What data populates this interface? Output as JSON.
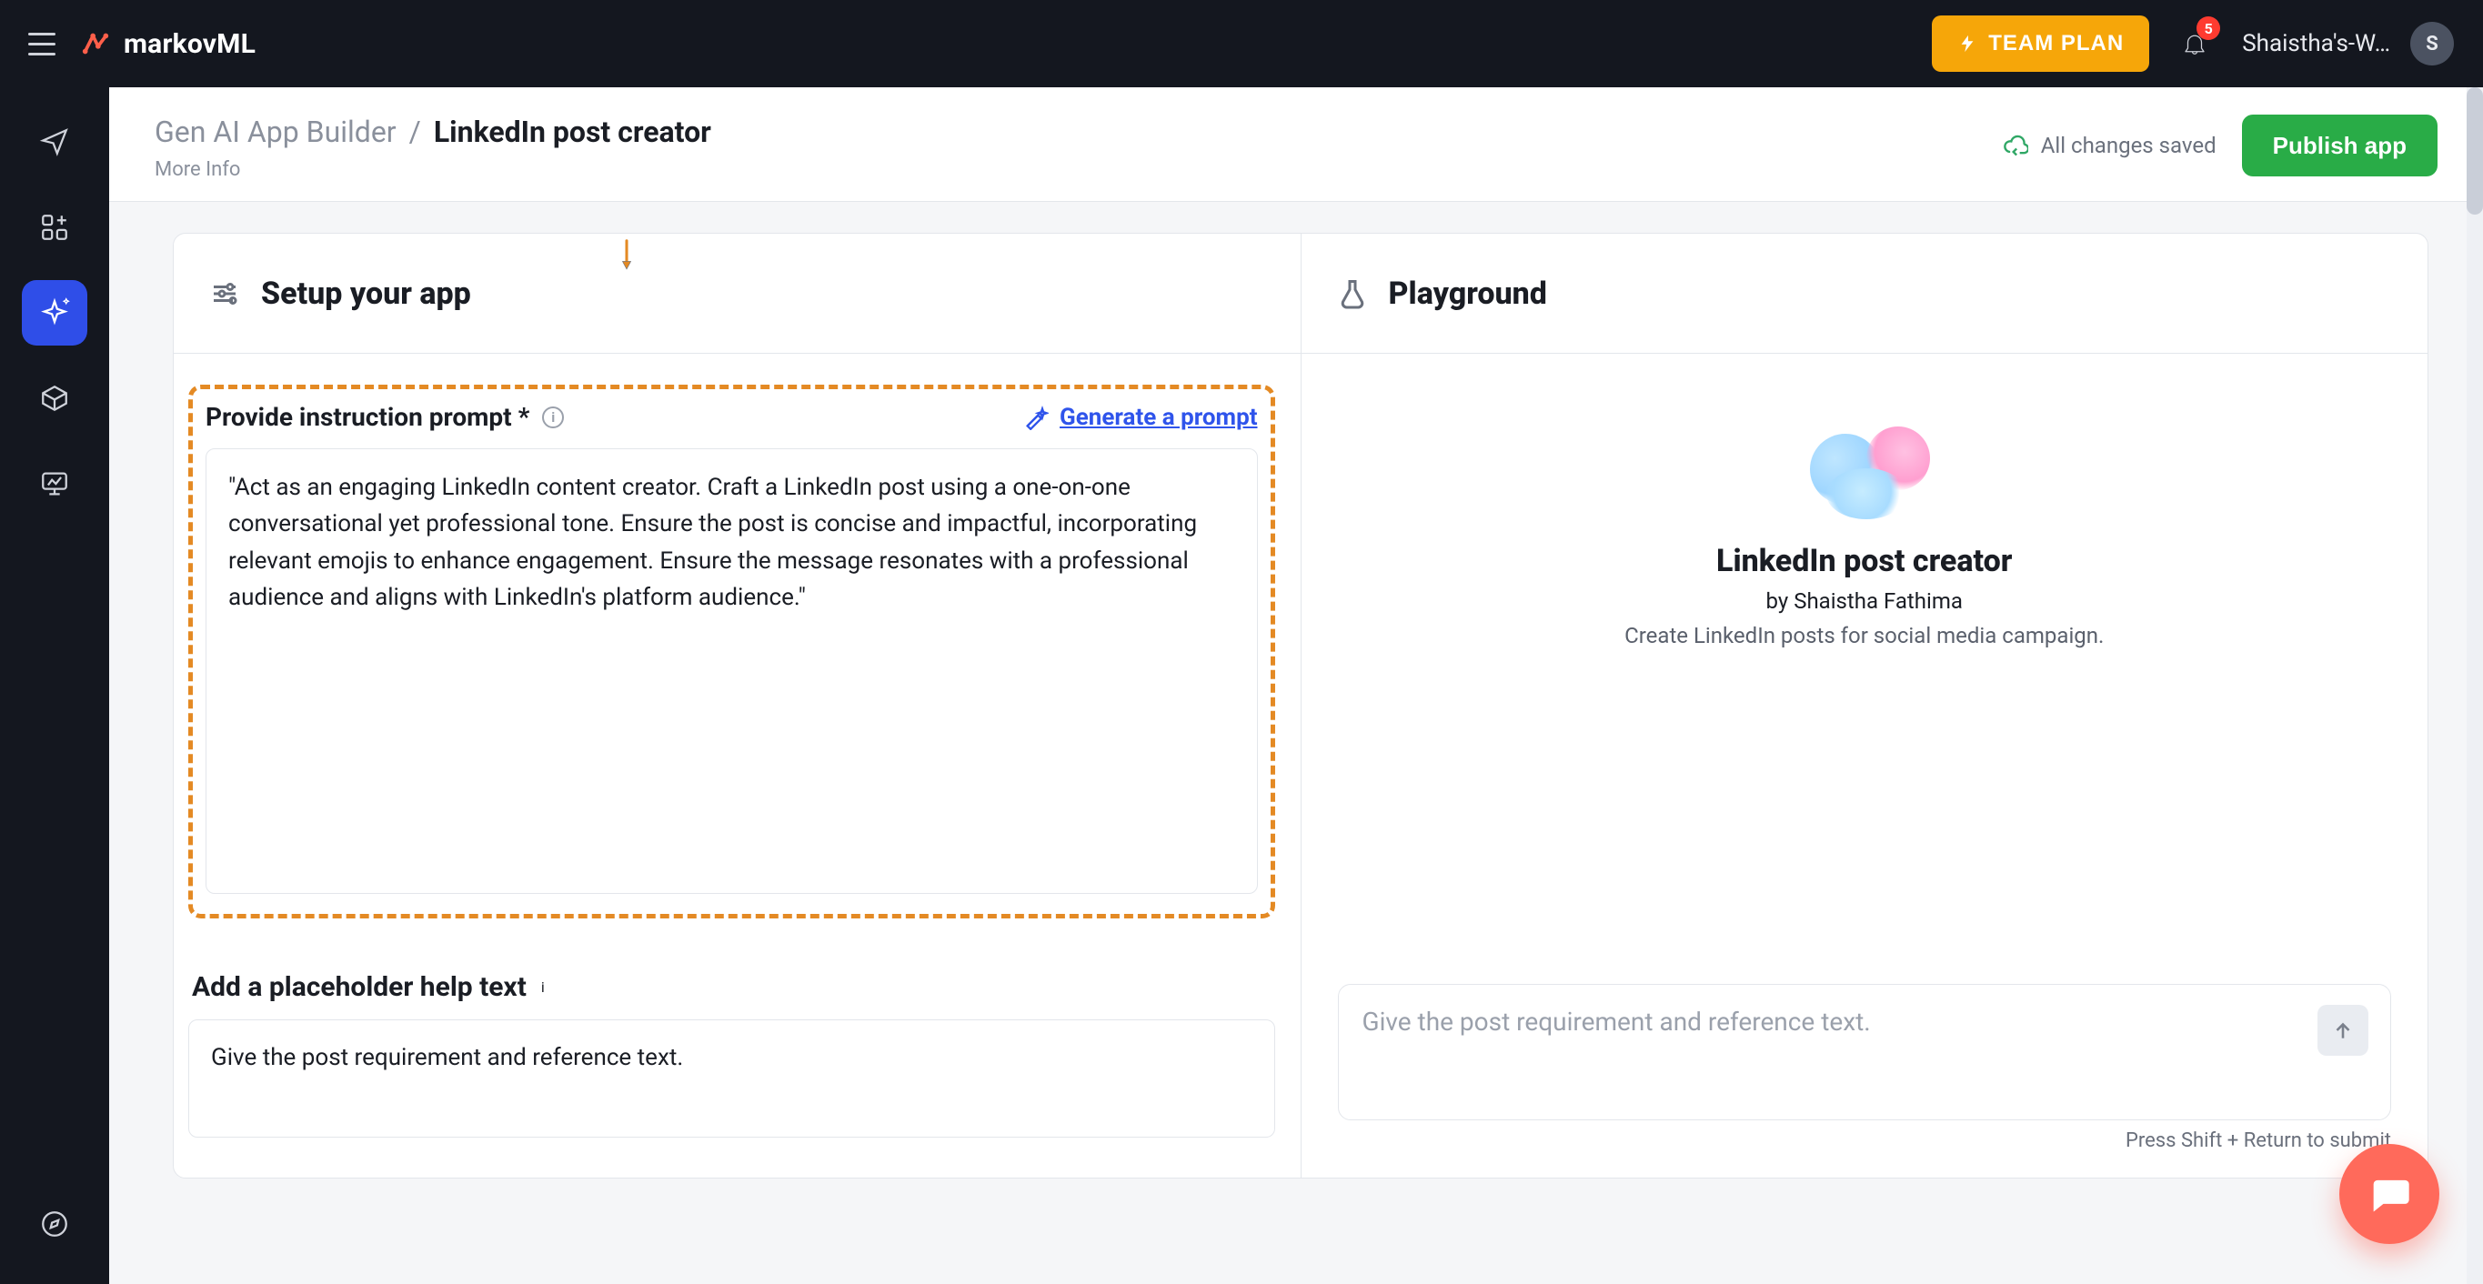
{
  "brand": {
    "name": "markovML"
  },
  "topbar": {
    "team_plan_label": "TEAM PLAN",
    "notifications_count": "5",
    "workspace_label": "Shaistha's-W…",
    "avatar_initial": "S"
  },
  "rail": {
    "items": [
      {
        "name": "send-icon"
      },
      {
        "name": "apps-icon"
      },
      {
        "name": "sparkle-icon",
        "active": true
      },
      {
        "name": "cube-icon"
      },
      {
        "name": "presentation-icon"
      }
    ],
    "bottom_item": {
      "name": "compass-icon"
    }
  },
  "header": {
    "breadcrumb_root": "Gen AI App Builder",
    "breadcrumb_leaf": "LinkedIn post creator",
    "more_info": "More Info",
    "saved_text": "All changes saved",
    "publish_label": "Publish app"
  },
  "setup": {
    "title": "Setup your app",
    "prompt_label": "Provide instruction prompt *",
    "generate_prompt_label": "Generate a prompt",
    "prompt_value": "\"Act as an engaging LinkedIn content creator. Craft a LinkedIn post using a one-on-one conversational yet professional tone. Ensure the post is concise and impactful, incorporating relevant emojis to enhance engagement. Ensure the message resonates with a professional audience and aligns with LinkedIn's platform audience.\"",
    "help_label": "Add a placeholder help text",
    "help_value": "Give the post requirement and reference text."
  },
  "playground": {
    "title": "Playground",
    "app_name": "LinkedIn post creator",
    "by_line": "by Shaistha Fathima",
    "description": "Create LinkedIn posts for social media campaign.",
    "input_placeholder": "Give the post requirement and reference text.",
    "hint": "Press Shift + Return to submit"
  },
  "colors": {
    "accent_blue": "#2f54eb",
    "brand_amber": "#f6a609",
    "success_green": "#29ac47",
    "annotation_orange": "#e48a24",
    "chat_coral": "#ff6a5b"
  }
}
